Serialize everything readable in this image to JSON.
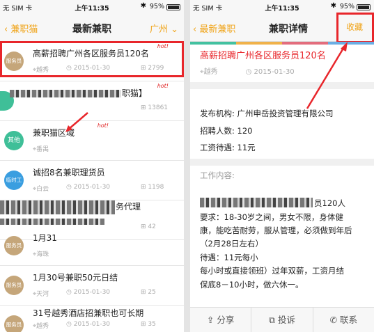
{
  "status_bar": {
    "carrier": "无 SIM 卡",
    "time": "上午11:35",
    "battery": "95%"
  },
  "list_screen": {
    "nav": {
      "back": "兼职猫",
      "title": "最新兼职",
      "city": "广州"
    },
    "items": [
      {
        "badge": "服务员",
        "title": "高薪招聘广州各区服务员120名",
        "hot": "hot!",
        "location": "越秀",
        "date": "2015-01-30",
        "views": "2799"
      },
      {
        "badge": "",
        "title": "职猫】",
        "hot": "hot!",
        "location": "",
        "date": "",
        "views": "13861"
      },
      {
        "badge": "其他",
        "title": "兼职猫区域",
        "hot": "hot!",
        "location": "番禺",
        "date": "",
        "views": ""
      },
      {
        "badge": "临时工",
        "title": "诚招8名兼职理货员",
        "hot": "",
        "location": "白云",
        "date": "2015-01-30",
        "views": "1198"
      },
      {
        "badge": "",
        "title": "务代理",
        "hot": "",
        "location": "",
        "date": "",
        "views": "42"
      },
      {
        "badge": "服务员",
        "title": "1月31",
        "hot": "",
        "location": "海珠",
        "date": "",
        "views": ""
      },
      {
        "badge": "服务员",
        "title": "1月30号兼职50元日结",
        "hot": "",
        "location": "天河",
        "date": "2015-01-30",
        "views": "25"
      },
      {
        "badge": "服务员",
        "title": "31号越秀酒店招兼职也可长期",
        "hot": "",
        "location": "越秀",
        "date": "2015-01-30",
        "views": "35"
      }
    ]
  },
  "detail_screen": {
    "nav": {
      "back": "最新兼职",
      "title": "兼职详情",
      "favorite": "收藏"
    },
    "job_title": "高薪招聘广州各区服务员120名",
    "location": "越秀",
    "date": "2015-01-30",
    "org": "发布机构: 广州申岳投资管理有限公司",
    "headcount": "招聘人数: 120",
    "salary": "工资待遇: 11元",
    "content_label": "工作内容:",
    "content_lines": [
      "员120人",
      "要求：18-30岁之间，男女不限，身体健",
      "康，能吃苦耐劳，服从管理，必须做到年后",
      "（2月28日左右）",
      "待遇：11元每小",
      "每小时或直接领班）过年双薪，工资月结",
      "保底8－10小时，做六休一。"
    ],
    "actions": {
      "share": "分享",
      "complain": "投诉",
      "contact": "联系"
    }
  }
}
